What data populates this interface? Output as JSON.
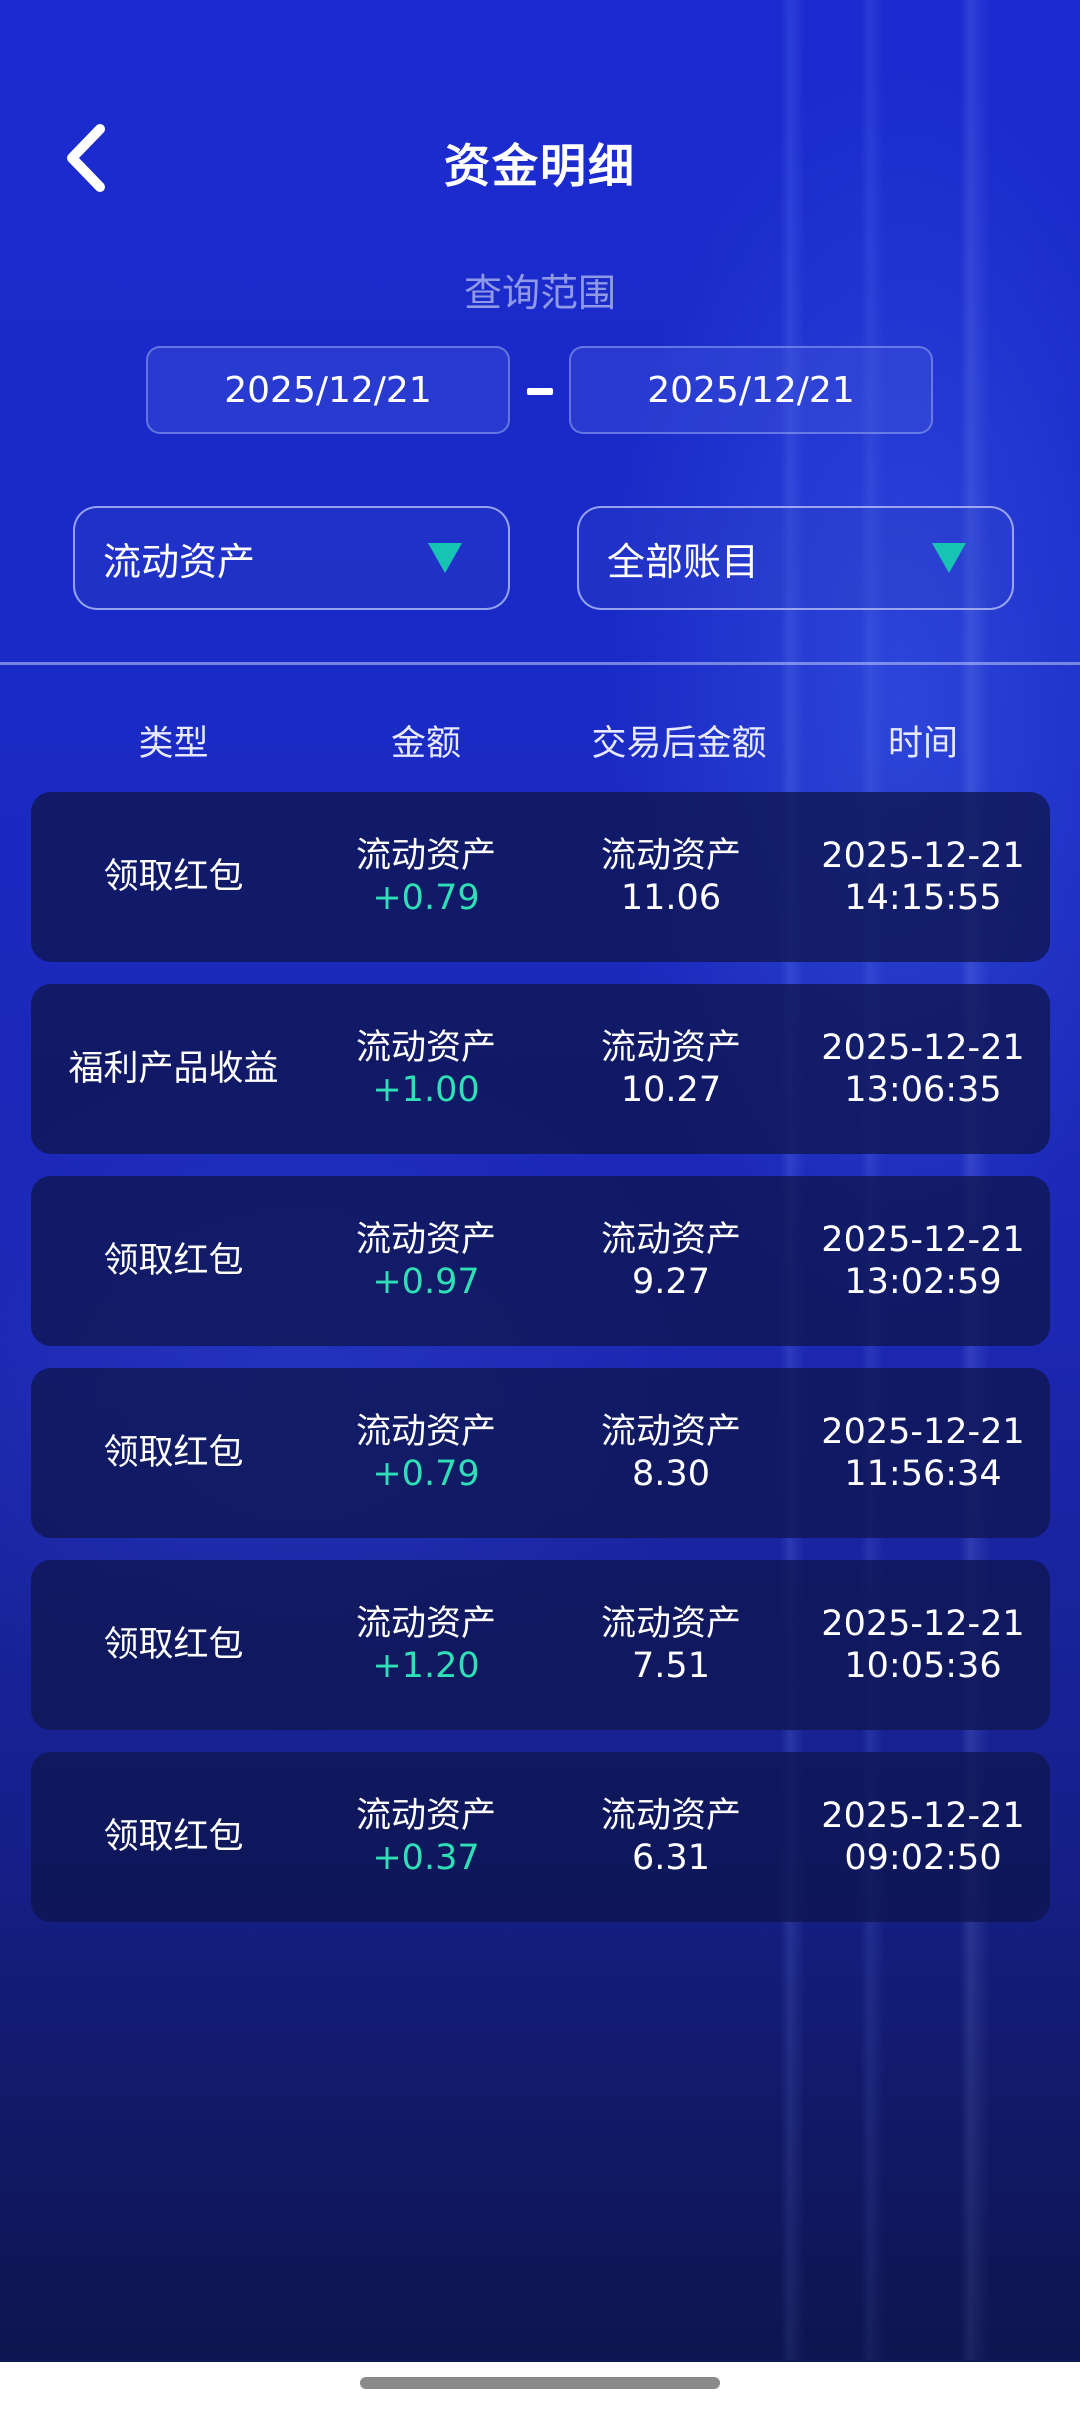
{
  "header": {
    "title": "资金明细",
    "back_icon": "chevron-left-icon"
  },
  "filter": {
    "range_label": "查询范围",
    "start_date": "2025/12/21",
    "end_date": "2025/12/21",
    "asset_select": "流动资产",
    "account_select": "全部账目"
  },
  "columns": {
    "type": "类型",
    "amount": "金额",
    "after_amount": "交易后金额",
    "time": "时间"
  },
  "rows": [
    {
      "type": "领取红包",
      "amount_label": "流动资产",
      "amount": "+0.79",
      "after_label": "流动资产",
      "after": "11.06",
      "date": "2025-12-21",
      "time": "14:15:55"
    },
    {
      "type": "福利产品收益",
      "amount_label": "流动资产",
      "amount": "+1.00",
      "after_label": "流动资产",
      "after": "10.27",
      "date": "2025-12-21",
      "time": "13:06:35"
    },
    {
      "type": "领取红包",
      "amount_label": "流动资产",
      "amount": "+0.97",
      "after_label": "流动资产",
      "after": "9.27",
      "date": "2025-12-21",
      "time": "13:02:59"
    },
    {
      "type": "领取红包",
      "amount_label": "流动资产",
      "amount": "+0.79",
      "after_label": "流动资产",
      "after": "8.30",
      "date": "2025-12-21",
      "time": "11:56:34"
    },
    {
      "type": "领取红包",
      "amount_label": "流动资产",
      "amount": "+1.20",
      "after_label": "流动资产",
      "after": "7.51",
      "date": "2025-12-21",
      "time": "10:05:36"
    },
    {
      "type": "领取红包",
      "amount_label": "流动资产",
      "amount": "+0.37",
      "after_label": "流动资产",
      "after": "6.31",
      "date": "2025-12-21",
      "time": "09:02:50"
    }
  ],
  "colors": {
    "accent": "#17c4b4",
    "positive": "#2fe0b6"
  }
}
